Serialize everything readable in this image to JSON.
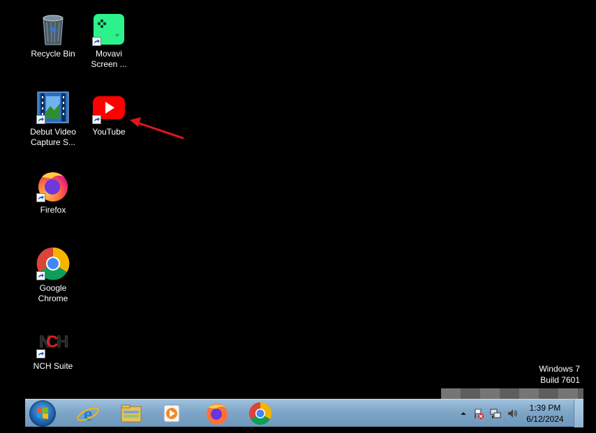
{
  "desktop": {
    "icons": [
      {
        "label": "Recycle Bin",
        "icon": "recycle-bin-icon"
      },
      {
        "label": "Movavi\nScreen ...",
        "icon": "movavi-icon"
      },
      {
        "label": "Debut Video\nCapture S...",
        "icon": "debut-video-icon"
      },
      {
        "label": "YouTube",
        "icon": "youtube-icon"
      },
      {
        "label": "Firefox",
        "icon": "firefox-icon"
      },
      {
        "label": "Google\nChrome",
        "icon": "chrome-icon"
      },
      {
        "label": "NCH Suite",
        "icon": "nch-suite-icon"
      }
    ]
  },
  "watermark": {
    "line1": "Windows 7",
    "line2": "Build 7601"
  },
  "taskbar": {
    "pinned": [
      "internet-explorer-icon",
      "windows-explorer-icon",
      "media-player-icon",
      "firefox-icon",
      "chrome-icon"
    ],
    "clock": {
      "time": "1:39 PM",
      "date": "6/12/2024"
    }
  },
  "colors": {
    "desktop_background": "#000000",
    "annotation_arrow": "#e0161b",
    "youtube_red": "#ff0000",
    "movavi_green": "#2cf28c"
  }
}
